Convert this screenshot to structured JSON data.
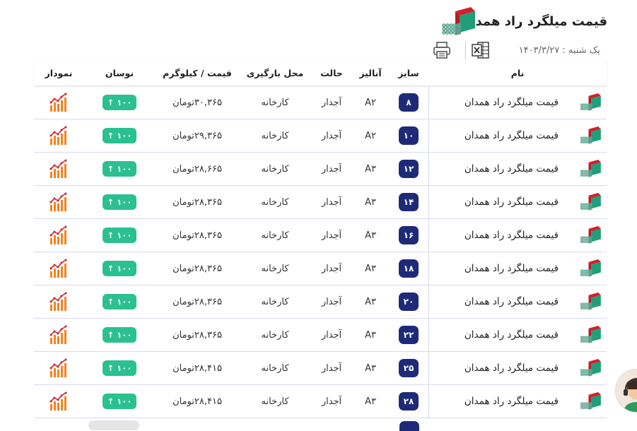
{
  "header": {
    "title": "قیمت میلگرد راد همدان",
    "date": "یک شنبه : ۱۴۰۳/۳/۲۷"
  },
  "toolbar": {
    "print_icon": "printer-icon",
    "excel_icon": "excel-icon"
  },
  "colors": {
    "size_badge": "#1e2a78",
    "oscillation_badge": "#2bc08f",
    "chart_orange": "#f58220",
    "logo_red": "#d3212c",
    "logo_green": "#1f9e7a"
  },
  "table": {
    "headers": {
      "name": "نام",
      "size": "سایز",
      "analysis": "آنالیز",
      "state": "حالت",
      "location": "محل بارگیری",
      "price": "قیمت / کیلوگرم",
      "oscillation": "نوسان",
      "chart": "نمودار"
    },
    "rows": [
      {
        "name": "قیمت میلگرد راد همدان",
        "size": "۸",
        "analysis": "A۲",
        "state": "آجدار",
        "location": "کارخانه",
        "price": "۳۰,۳۶۵تومان",
        "oscillation": "↑ ۱۰۰"
      },
      {
        "name": "قیمت میلگرد راد همدان",
        "size": "۱۰",
        "analysis": "A۲",
        "state": "آجدار",
        "location": "کارخانه",
        "price": "۲۹,۳۶۵تومان",
        "oscillation": "↑ ۱۰۰"
      },
      {
        "name": "قیمت میلگرد راد همدان",
        "size": "۱۲",
        "analysis": "A۳",
        "state": "آجدار",
        "location": "کارخانه",
        "price": "۲۸,۶۶۵تومان",
        "oscillation": "↑ ۱۰۰"
      },
      {
        "name": "قیمت میلگرد راد همدان",
        "size": "۱۴",
        "analysis": "A۳",
        "state": "آجدار",
        "location": "کارخانه",
        "price": "۲۸,۳۶۵تومان",
        "oscillation": "↑ ۱۰۰"
      },
      {
        "name": "قیمت میلگرد راد همدان",
        "size": "۱۶",
        "analysis": "A۳",
        "state": "آجدار",
        "location": "کارخانه",
        "price": "۲۸,۳۶۵تومان",
        "oscillation": "↑ ۱۰۰"
      },
      {
        "name": "قیمت میلگرد راد همدان",
        "size": "۱۸",
        "analysis": "A۳",
        "state": "آجدار",
        "location": "کارخانه",
        "price": "۲۸,۳۶۵تومان",
        "oscillation": "↑ ۱۰۰"
      },
      {
        "name": "قیمت میلگرد راد همدان",
        "size": "۲۰",
        "analysis": "A۳",
        "state": "آجدار",
        "location": "کارخانه",
        "price": "۲۸,۳۶۵تومان",
        "oscillation": "↑ ۱۰۰"
      },
      {
        "name": "قیمت میلگرد راد همدان",
        "size": "۲۲",
        "analysis": "A۳",
        "state": "آجدار",
        "location": "کارخانه",
        "price": "۲۸,۳۶۵تومان",
        "oscillation": "↑ ۱۰۰"
      },
      {
        "name": "قیمت میلگرد راد همدان",
        "size": "۲۵",
        "analysis": "A۳",
        "state": "آجدار",
        "location": "کارخانه",
        "price": "۲۸,۴۱۵تومان",
        "oscillation": "↑ ۱۰۰"
      },
      {
        "name": "قیمت میلگرد راد همدان",
        "size": "۲۸",
        "analysis": "A۳",
        "state": "آجدار",
        "location": "کارخانه",
        "price": "۲۸,۴۱۵تومان",
        "oscillation": "↑ ۱۰۰"
      }
    ]
  }
}
